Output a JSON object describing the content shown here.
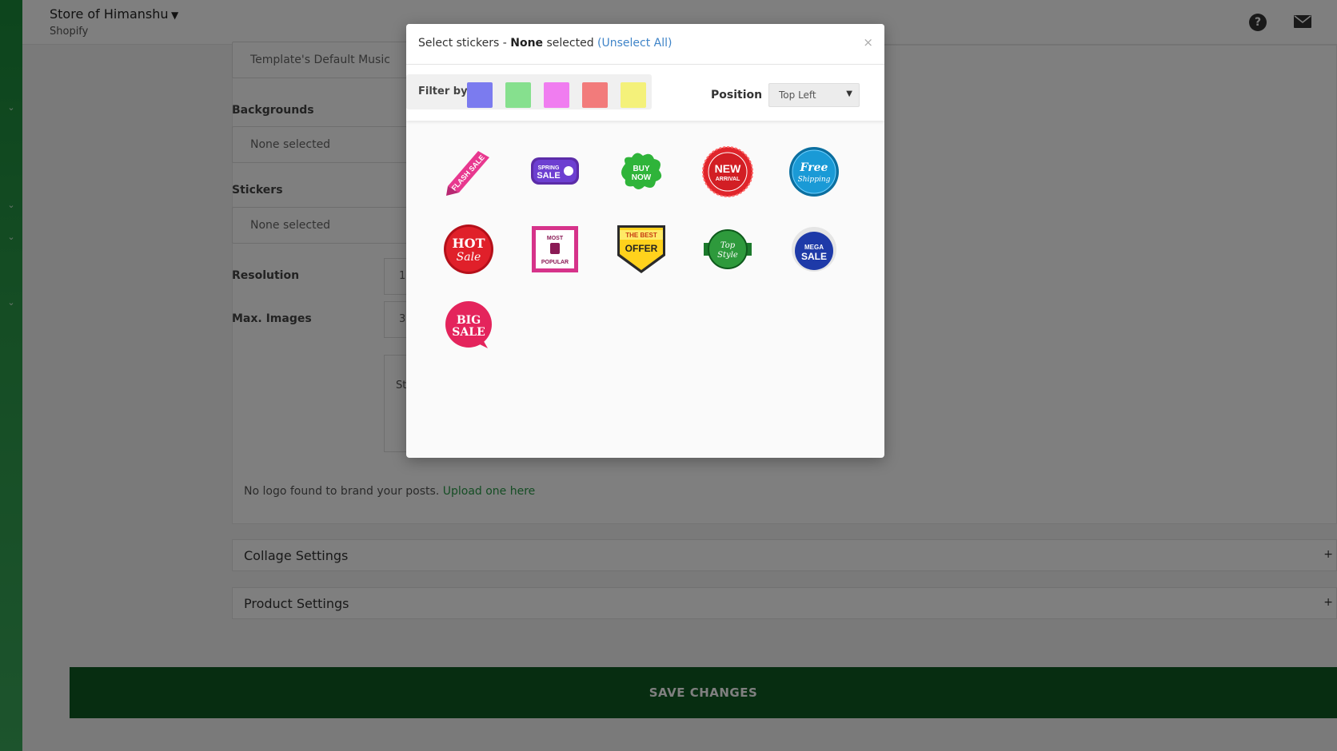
{
  "topbar": {
    "store_name": "Store of Himanshu",
    "platform": "Shopify"
  },
  "form": {
    "music_value": "Template's Default Music",
    "backgrounds_label": "Backgrounds",
    "backgrounds_value": "None selected",
    "stickers_label": "Stickers",
    "stickers_value": "None selected",
    "resolution_label": "Resolution",
    "resolution_value": "1",
    "max_images_label": "Max. Images",
    "max_images_value": "3",
    "partial_label": "St",
    "logo_note": "No logo found to brand your posts.",
    "logo_link": "Upload one here"
  },
  "accordions": [
    {
      "label": "Collage Settings",
      "icon": "+"
    },
    {
      "label": "Product Settings",
      "icon": "+"
    }
  ],
  "save_label": "SAVE CHANGES",
  "modal": {
    "title_prefix": "Select stickers - ",
    "selected_count": "None",
    "title_suffix": " selected ",
    "unselect_all": "(Unselect All)",
    "close": "×",
    "filter_label": "Filter by:",
    "filter_colors": [
      "#7b7bef",
      "#86e08e",
      "#f07df0",
      "#f27b7b",
      "#f4f17a"
    ],
    "position_label": "Position",
    "position_value": "Top Left",
    "stickers": [
      {
        "name": "flash-sale-sticker",
        "text": "FLASH SALE"
      },
      {
        "name": "spring-sale-sticker",
        "text": "SPRING SALE"
      },
      {
        "name": "buy-now-sticker",
        "text": "BUY NOW"
      },
      {
        "name": "new-arrival-sticker",
        "text": "NEW ARRIVAL"
      },
      {
        "name": "free-shipping-sticker",
        "text": "Free Shipping"
      },
      {
        "name": "hot-sale-sticker",
        "text": "HOT Sale"
      },
      {
        "name": "most-popular-sticker",
        "text": "MOST POPULAR"
      },
      {
        "name": "best-offer-sticker",
        "text": "THE BEST OFFER"
      },
      {
        "name": "top-style-sticker",
        "text": "Top Style"
      },
      {
        "name": "mega-sale-sticker",
        "text": "MEGA SALE"
      },
      {
        "name": "big-sale-sticker",
        "text": "BIG SALE"
      }
    ]
  }
}
